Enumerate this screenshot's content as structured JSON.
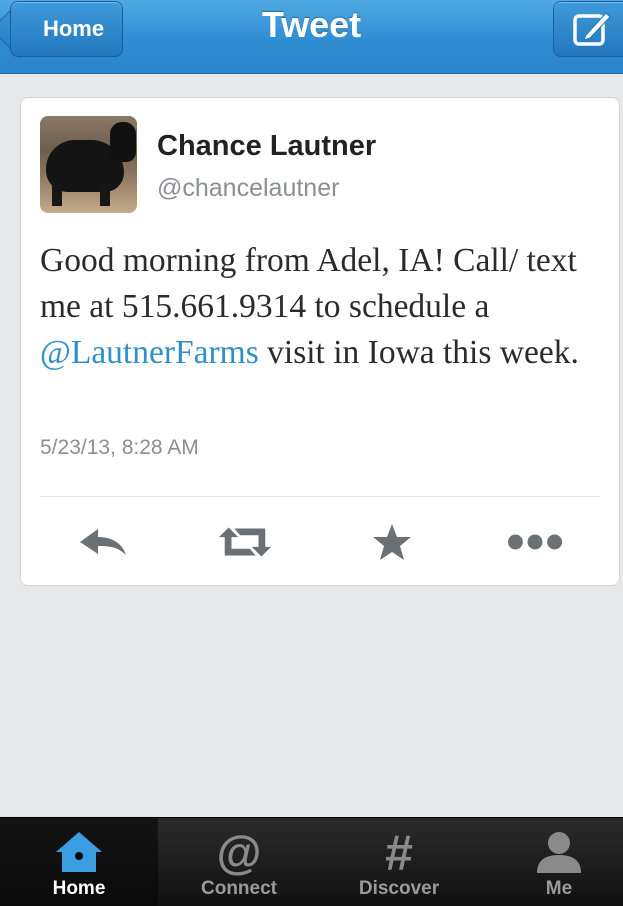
{
  "nav": {
    "back_label": "Home",
    "title": "Tweet",
    "compose_icon": "compose-icon"
  },
  "tweet": {
    "author_name": "Chance Lautner",
    "author_handle": "@chancelautner",
    "avatar_icon": "cow-photo",
    "text_part1": "Good morning from Adel, IA! Call/ text me at 515.661.9314 to schedule a ",
    "mention": "@LautnerFarms",
    "text_part2": " visit in Iowa this week.",
    "timestamp": "5/23/13, 8:28 AM"
  },
  "actions": [
    {
      "icon": "reply-icon"
    },
    {
      "icon": "retweet-icon"
    },
    {
      "icon": "favorite-star-icon"
    },
    {
      "icon": "more-dots-icon"
    }
  ],
  "tabs": [
    {
      "label": "Home",
      "icon": "home-icon",
      "active": true
    },
    {
      "label": "Connect",
      "icon": "at-sign-icon",
      "active": false
    },
    {
      "label": "Discover",
      "icon": "hashtag-icon",
      "active": false
    },
    {
      "label": "Me",
      "icon": "person-icon",
      "active": false
    }
  ],
  "colors": {
    "nav_blue": "#2f8dd2",
    "mention_blue": "#2f8fc9",
    "home_icon_blue": "#3a9ee0"
  }
}
